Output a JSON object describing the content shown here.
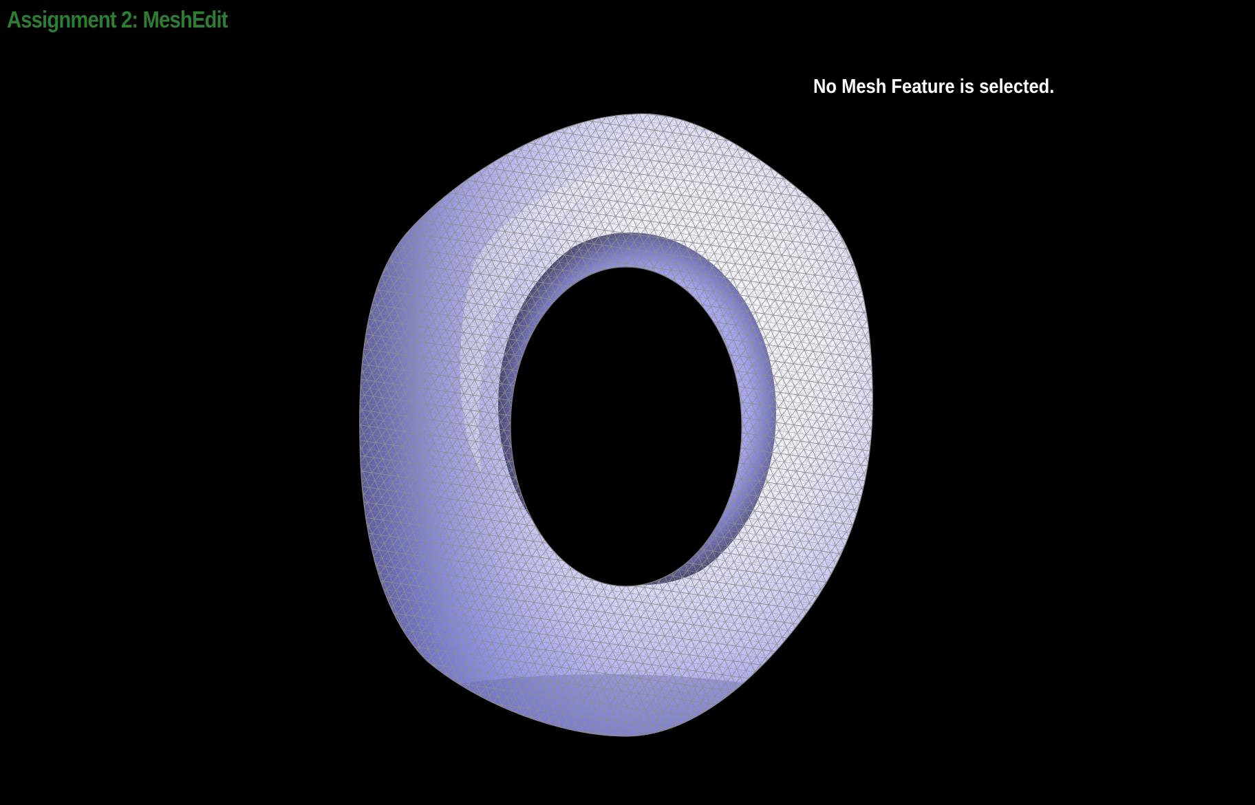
{
  "app": {
    "title": "Assignment 2: MeshEdit",
    "title_color": "#2e7d32"
  },
  "status": {
    "message": "No Mesh Feature is selected."
  },
  "viewport": {
    "background": "#000000",
    "model": {
      "shape": "torus",
      "render_mode": "shaded-wireframe",
      "base_color": "#8a8aef",
      "highlight_color": "#ffffff",
      "edge_color": "#9a9a9a"
    }
  }
}
